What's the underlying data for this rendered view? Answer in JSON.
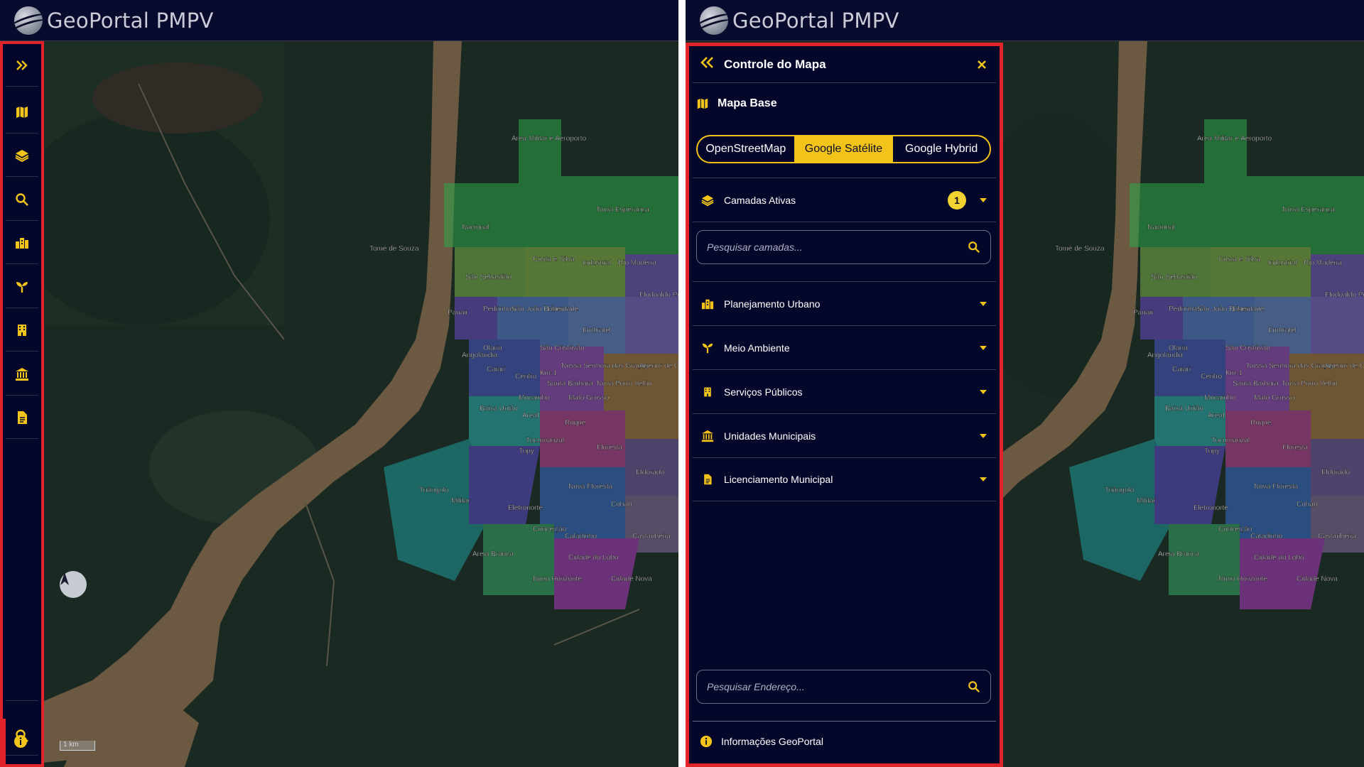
{
  "app": {
    "title": "GeoPortal PMPV",
    "brand_color": "#f2c41a",
    "alert_outline_color": "#e0242a"
  },
  "map": {
    "scale_label": "1 km",
    "compass_label": "N",
    "neighborhoods": [
      "Área Militar e Aeroporto",
      "Nova Esperança",
      "Nacional",
      "Tomé de Souza",
      "Costa e Silva",
      "Industrial",
      "Rio Madeira",
      "São Sebastião",
      "Panair",
      "Pedrinhas",
      "São João Bosco",
      "Liberdade",
      "Embratel",
      "Flodoaldo Pontes Pinto",
      "Olaria",
      "São Cristóvão",
      "Nossa Senhora das Graças",
      "Agenor de Carvalho",
      "Angolândia",
      "Caiari",
      "Centro",
      "Km-1",
      "Santa Bárbara",
      "Mato Grosso",
      "Nova Porto Velho",
      "Mocambo",
      "Baixa União",
      "Areal",
      "Roque",
      "Tucumanzal",
      "Tupy",
      "Floresta",
      "Eldorado",
      "Triângulo",
      "Militar",
      "Nova Floresta",
      "Eletronorte",
      "Cohab",
      "Conceição",
      "Caladinho",
      "Castanheira",
      "Areia Branca",
      "Cidade do Lobo",
      "Novo Horizonte",
      "Cidade Nova"
    ]
  },
  "rail": {
    "items": [
      {
        "icon": "double-chevron-right-icon"
      },
      {
        "icon": "map-icon"
      },
      {
        "icon": "layers-icon"
      },
      {
        "icon": "search-icon"
      },
      {
        "icon": "city-icon"
      },
      {
        "icon": "seedling-icon"
      },
      {
        "icon": "building-icon"
      },
      {
        "icon": "landmark-icon"
      },
      {
        "icon": "document-icon"
      }
    ],
    "bottom": [
      {
        "icon": "search-icon"
      },
      {
        "icon": "info-icon"
      }
    ]
  },
  "panel": {
    "title": "Controle do Mapa",
    "base_map": {
      "title": "Mapa Base",
      "options": [
        "OpenStreetMap",
        "Google Satélite",
        "Google Hybrid"
      ],
      "selected": "Google Satélite"
    },
    "active_layers": {
      "label": "Camadas Ativas",
      "count": "1"
    },
    "layer_search": {
      "placeholder": "Pesquisar camadas..."
    },
    "categories": [
      {
        "label": "Planejamento Urbano",
        "icon": "city-icon"
      },
      {
        "label": "Meio Ambiente",
        "icon": "seedling-icon"
      },
      {
        "label": "Serviços Públicos",
        "icon": "building-icon"
      },
      {
        "label": "Unidades Municipais",
        "icon": "landmark-icon"
      },
      {
        "label": "Licenciamento Municipal",
        "icon": "document-icon"
      }
    ],
    "address_search": {
      "placeholder": "Pesquisar Endereço..."
    },
    "footer": {
      "label": "Informações GeoPortal"
    }
  }
}
